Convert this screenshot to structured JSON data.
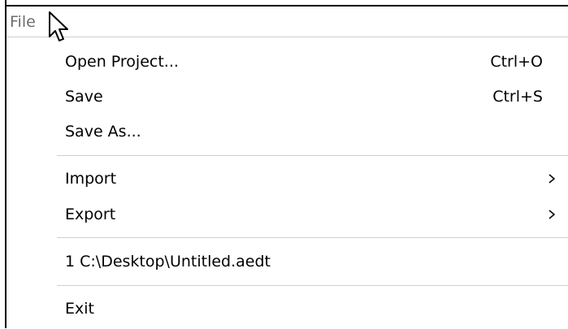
{
  "menubar": {
    "title": "File"
  },
  "menu": {
    "items": [
      {
        "label": "Open Project...",
        "shortcut": "Ctrl+O"
      },
      {
        "label": "Save",
        "shortcut": "Ctrl+S"
      },
      {
        "label": "Save As...",
        "shortcut": ""
      },
      {
        "label": "Import",
        "submenu": true
      },
      {
        "label": "Export",
        "submenu": true
      },
      {
        "label": "1 C:\\Desktop\\Untitled.aedt",
        "shortcut": ""
      },
      {
        "label": "Exit",
        "shortcut": ""
      }
    ]
  },
  "icons": {
    "cursor": "arrow-cursor-icon",
    "submenu_arrow": "chevron-right-icon"
  },
  "colors": {
    "menu_title": "#6d6d6d",
    "separator": "#cfcfcf",
    "border": "#000000"
  }
}
